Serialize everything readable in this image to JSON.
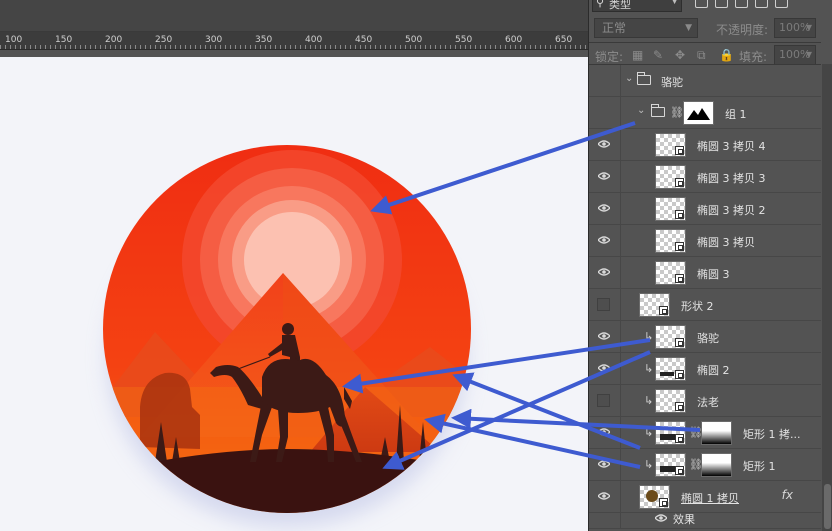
{
  "ruler": {
    "labels": [
      "100",
      "150",
      "200",
      "250",
      "300",
      "350",
      "400",
      "450",
      "500",
      "550",
      "600",
      "650"
    ]
  },
  "panel": {
    "filter_label": "类型",
    "blend_mode": "正常",
    "opacity_label": "不透明度:",
    "opacity_value": "100%",
    "lock_label": "锁定:",
    "fill_label": "填充:",
    "fill_value": "100%"
  },
  "layers": [
    {
      "name": "骆驼",
      "kind": "group",
      "visible": true
    },
    {
      "name": "组 1",
      "kind": "group",
      "visible": true
    },
    {
      "name": "椭圆 3 拷贝 4",
      "kind": "shape",
      "visible": true
    },
    {
      "name": "椭圆 3 拷贝 3",
      "kind": "shape",
      "visible": true
    },
    {
      "name": "椭圆 3 拷贝 2",
      "kind": "shape",
      "visible": true
    },
    {
      "name": "椭圆 3 拷贝",
      "kind": "shape",
      "visible": true
    },
    {
      "name": "椭圆 3",
      "kind": "shape",
      "visible": true
    },
    {
      "name": "形状 2",
      "kind": "shape",
      "visible": false
    },
    {
      "name": "骆驼",
      "kind": "shape",
      "visible": true
    },
    {
      "name": "椭圆 2",
      "kind": "shape",
      "visible": true
    },
    {
      "name": "法老",
      "kind": "shape",
      "visible": false
    },
    {
      "name": "矩形 1 拷...",
      "kind": "shape",
      "visible": true
    },
    {
      "name": "矩形 1",
      "kind": "shape",
      "visible": true
    },
    {
      "name": "椭圆 1 拷贝",
      "kind": "shape",
      "visible": true,
      "fx": "fx"
    },
    {
      "name": "效果",
      "kind": "effect",
      "visible": true
    }
  ],
  "colors": {
    "sun": "#fcc1b1",
    "sky_top": "#f02d12",
    "sky_bottom": "#f56010",
    "ground": "#3a1210",
    "silhouette": "#3c1a16",
    "arrow": "#3e5bd0"
  }
}
